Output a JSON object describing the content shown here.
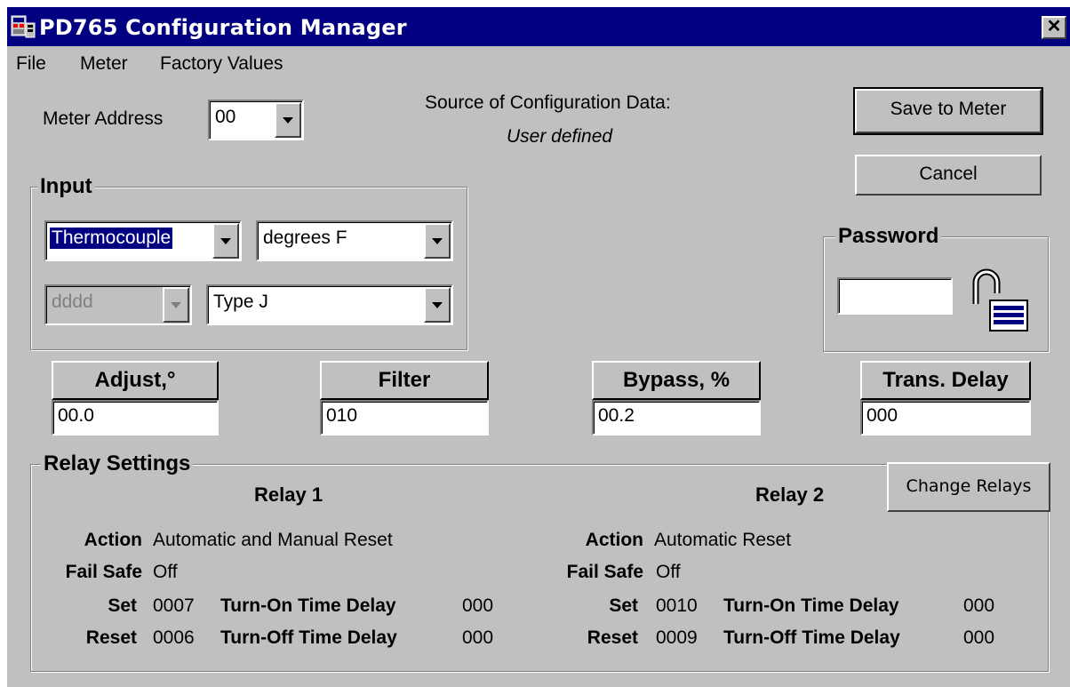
{
  "window": {
    "title": "PD765 Configuration Manager",
    "close_glyph": "✕"
  },
  "menu": {
    "file": "File",
    "meter": "Meter",
    "factory": "Factory Values"
  },
  "meter_address": {
    "label": "Meter Address",
    "value": "00"
  },
  "source": {
    "label": "Source of Configuration Data:",
    "value": "User defined"
  },
  "buttons": {
    "save": "Save to Meter",
    "cancel": "Cancel",
    "change_relays": "Change Relays"
  },
  "input": {
    "title": "Input",
    "type_value": "Thermocouple",
    "units_value": "degrees F",
    "decimal_value": "dddd",
    "tc_type_value": "Type J"
  },
  "password": {
    "title": "Password",
    "value": ""
  },
  "fields": {
    "adjust": {
      "label": "Adjust,°",
      "value": "00.0"
    },
    "filter": {
      "label": "Filter",
      "value": "010"
    },
    "bypass": {
      "label": "Bypass, %",
      "value": "00.2"
    },
    "trans_delay": {
      "label": "Trans. Delay",
      "value": "000"
    }
  },
  "relay_settings": {
    "title": "Relay Settings",
    "keys": {
      "action": "Action",
      "fail_safe": "Fail Safe",
      "set": "Set",
      "reset": "Reset",
      "turn_on": "Turn-On Time Delay",
      "turn_off": "Turn-Off Time Delay"
    },
    "relay1": {
      "name": "Relay 1",
      "action": "Automatic and Manual Reset",
      "fail_safe": "Off",
      "set": "0007",
      "reset": "0006",
      "turn_on": "000",
      "turn_off": "000"
    },
    "relay2": {
      "name": "Relay 2",
      "action": "Automatic Reset",
      "fail_safe": "Off",
      "set": "0010",
      "reset": "0009",
      "turn_on": "000",
      "turn_off": "000"
    }
  },
  "icons": {
    "app": "app-icon",
    "lock": "padlock-open-icon"
  },
  "colors": {
    "titlebar": "#000080",
    "face": "#c0c0c0",
    "selection": "#000080"
  }
}
